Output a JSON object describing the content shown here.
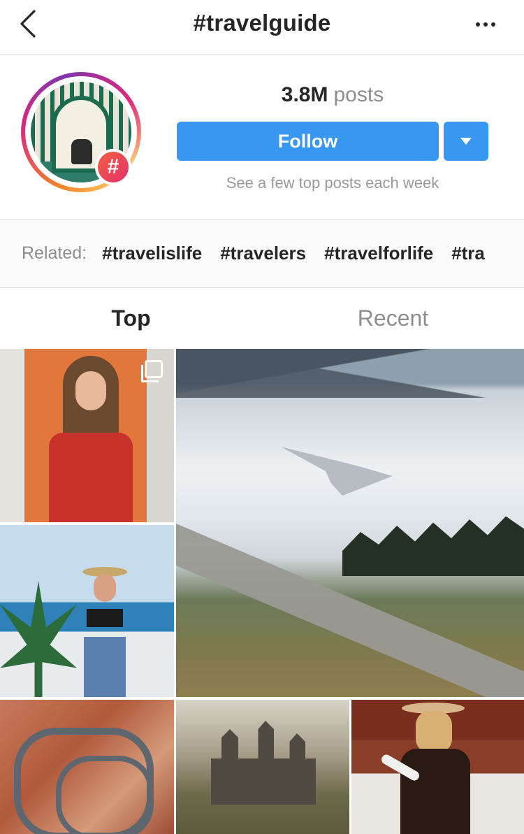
{
  "header": {
    "title": "#travelguide",
    "back_icon": "chevron-left-icon",
    "more_icon": "more-horizontal-icon"
  },
  "profile": {
    "posts_count": "3.8M",
    "posts_label": "posts",
    "follow_label": "Follow",
    "subtitle": "See a few top posts each week",
    "hash_badge": "#"
  },
  "related": {
    "label": "Related:",
    "tags": [
      "#travelislife",
      "#travelers",
      "#travelforlife",
      "#tra"
    ]
  },
  "tabs": [
    {
      "label": "Top",
      "active": true
    },
    {
      "label": "Recent",
      "active": false
    }
  ],
  "colors": {
    "follow_blue": "#3897f0",
    "text_dark": "#262626",
    "text_gray": "#8e8e8e"
  }
}
